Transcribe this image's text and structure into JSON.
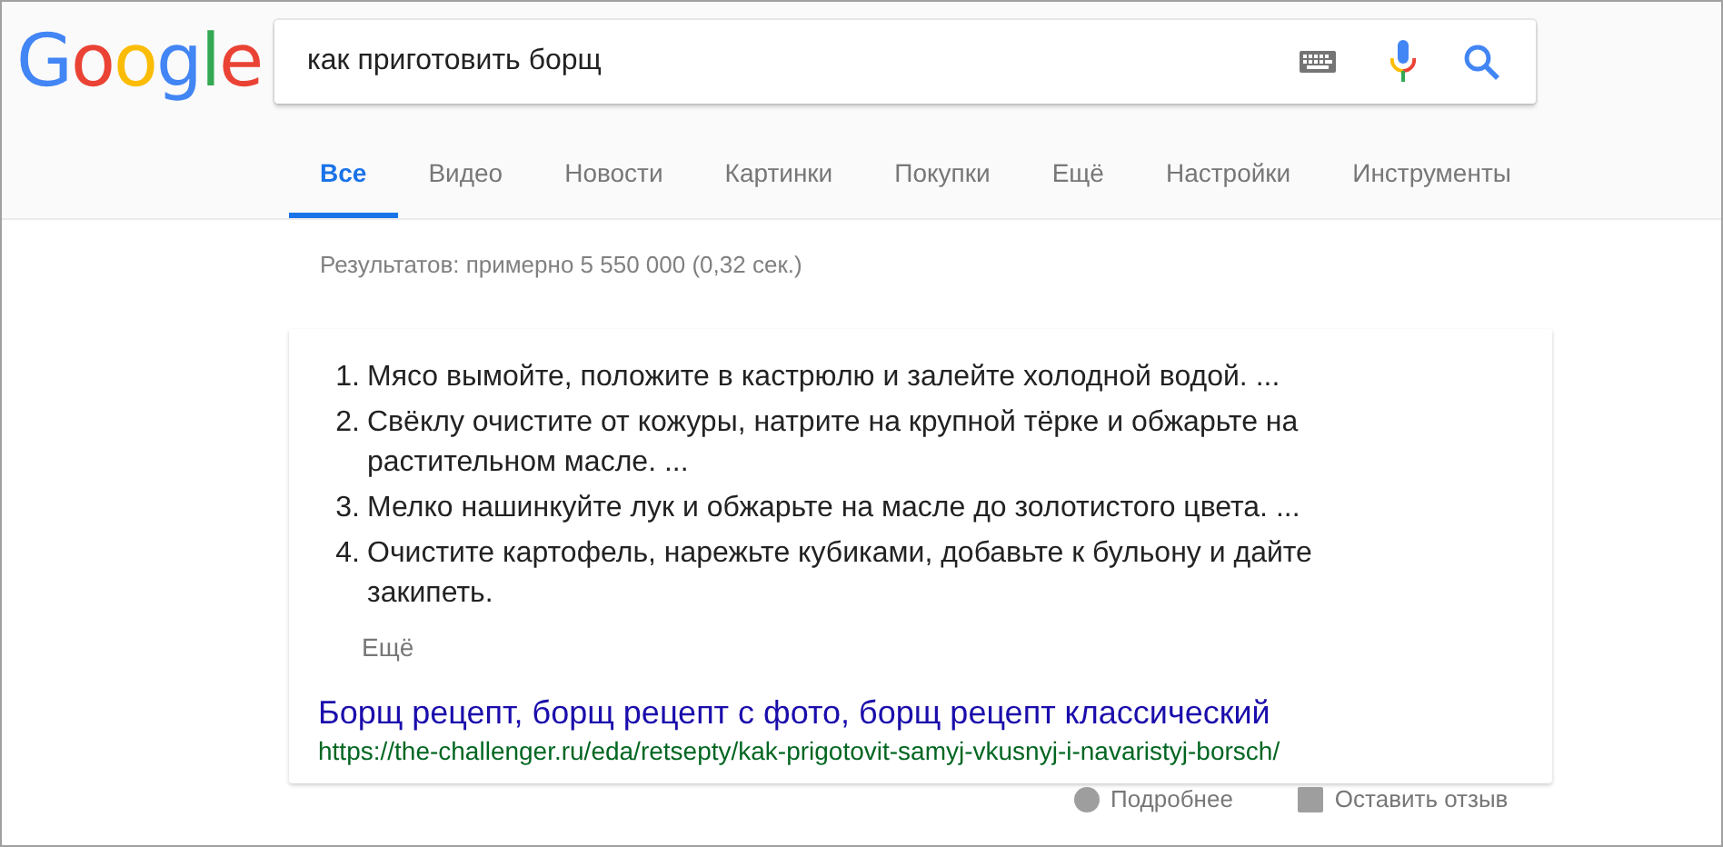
{
  "logo": "Google",
  "search": {
    "value": "как приготовить борщ"
  },
  "tabs": [
    {
      "label": "Все",
      "selected": true
    },
    {
      "label": "Видео",
      "selected": false
    },
    {
      "label": "Новости",
      "selected": false
    },
    {
      "label": "Картинки",
      "selected": false
    },
    {
      "label": "Покупки",
      "selected": false
    },
    {
      "label": "Ещё",
      "selected": false
    },
    {
      "label": "Настройки",
      "selected": false
    },
    {
      "label": "Инструменты",
      "selected": false
    }
  ],
  "result_stats": "Результатов: примерно 5 550 000 (0,32 сек.)",
  "snippet": {
    "steps": [
      {
        "number": "1.",
        "text": "Мясо вымойте, положите в кастрюлю и залейте холодной водой. ..."
      },
      {
        "number": "2.",
        "text": "Свёклу очистите от кожуры, натрите на крупной тёрке и обжарьте на растительном масле. ..."
      },
      {
        "number": "3.",
        "text": "Мелко нашинкуйте лук и обжарьте на масле до золотистого цвета. ..."
      },
      {
        "number": "4.",
        "text": "Очистите картофель, нарежьте кубиками, добавьте к бульону и дайте закипеть."
      }
    ],
    "more": "Ещё",
    "title": "Борщ рецепт, борщ рецепт с фото, борщ рецепт классический",
    "url": "https://the-challenger.ru/eda/retsepty/kak-prigotovit-samyj-vkusnyj-i-navaristyj-borsch/"
  },
  "footer": {
    "about": "Подробнее",
    "feedback": "Оставить отзыв"
  }
}
